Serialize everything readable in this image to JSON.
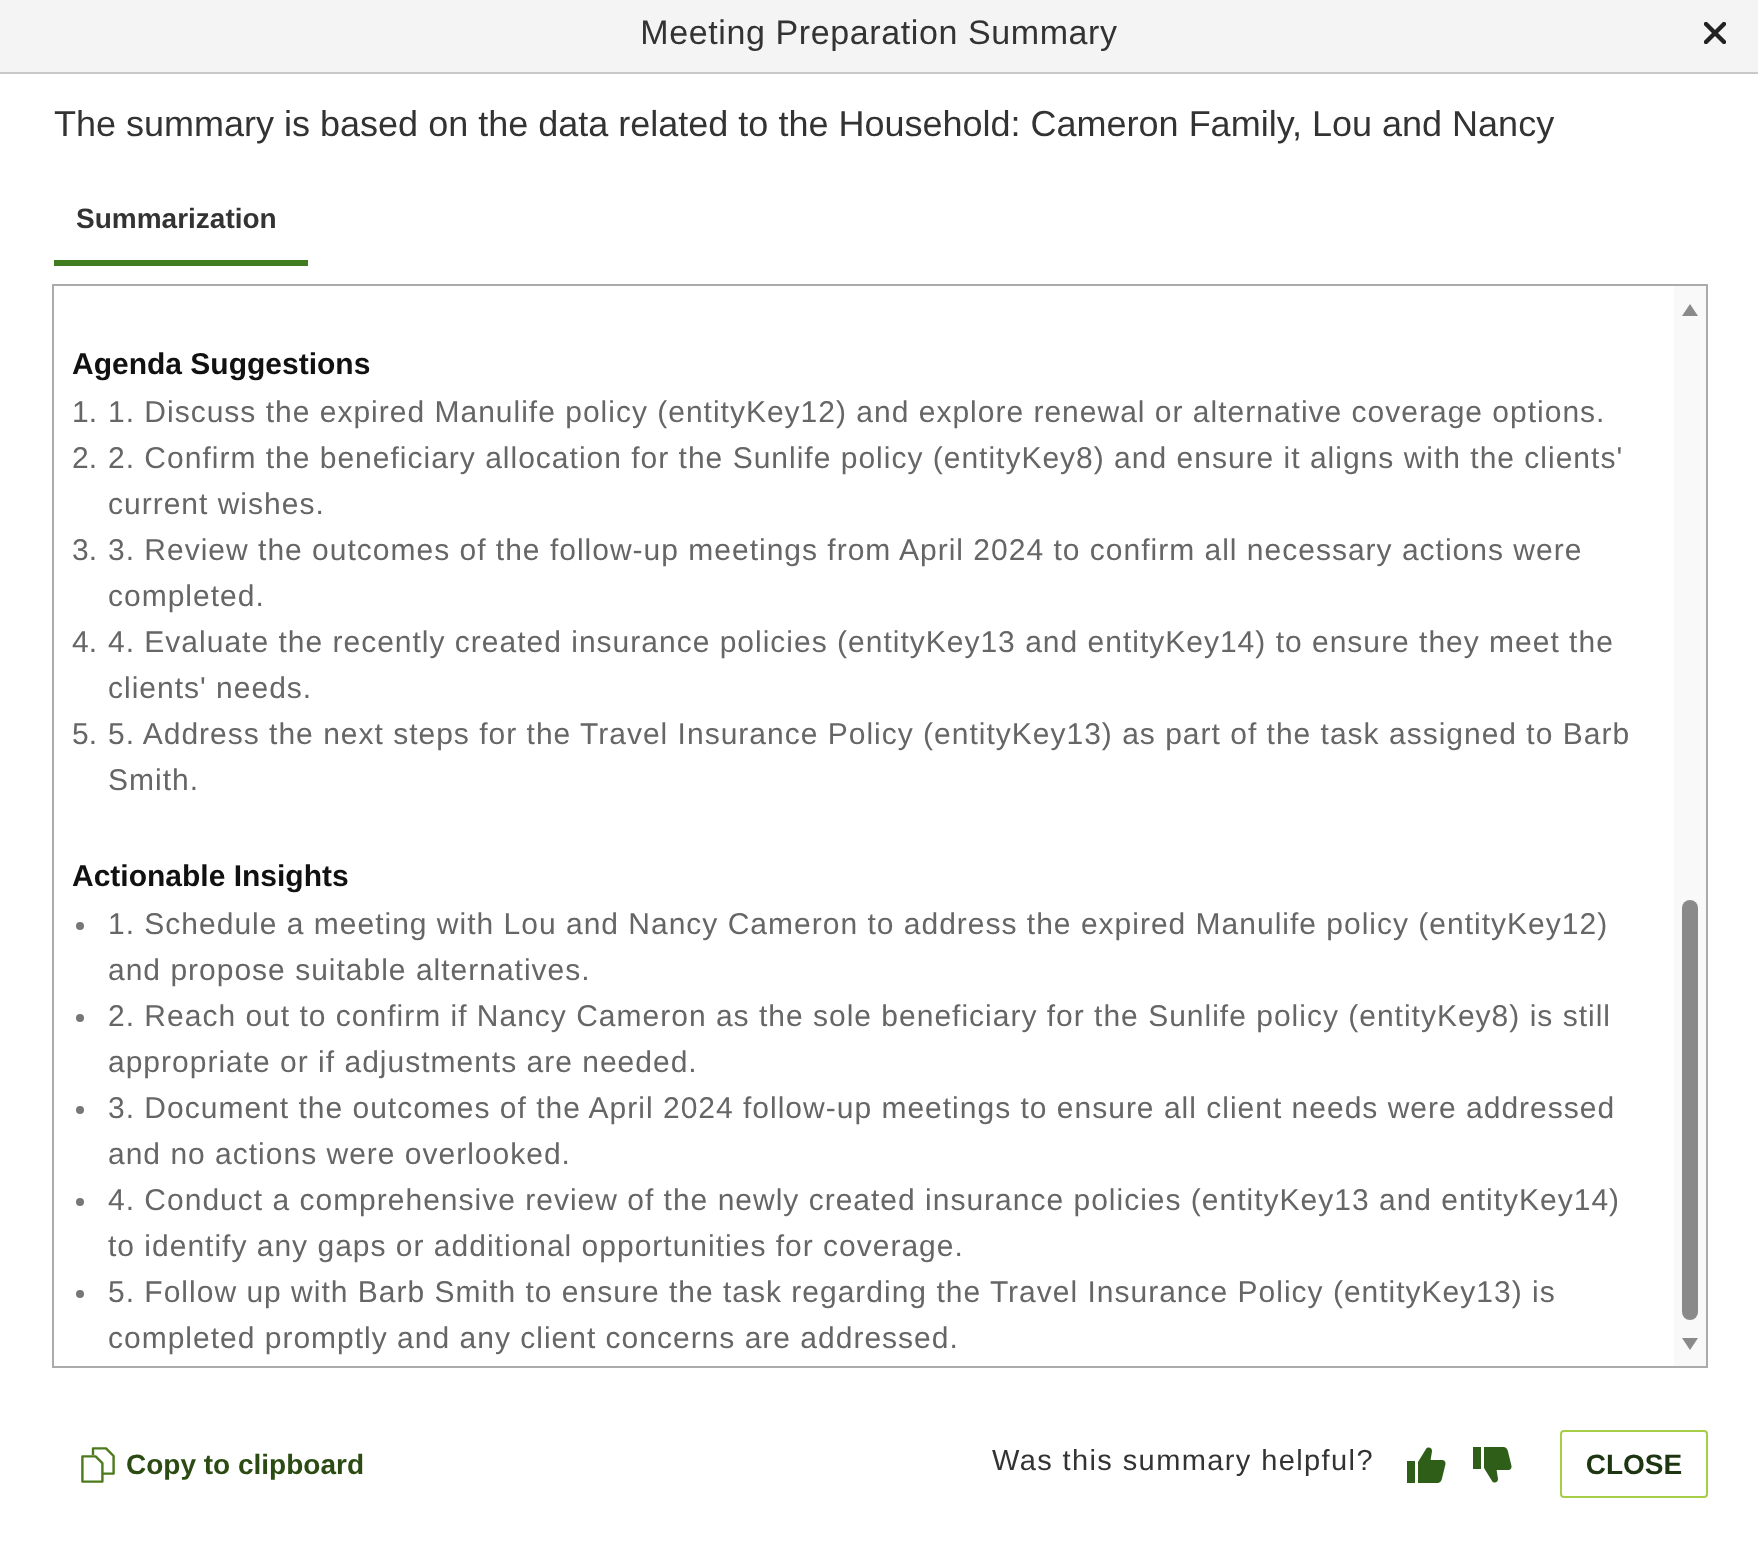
{
  "window": {
    "title": "Meeting Preparation Summary"
  },
  "intro": "The summary is based on the data related to the Household: Cameron Family, Lou and Nancy",
  "tabs": [
    {
      "label": "Summarization",
      "selected": true
    }
  ],
  "sections": [
    {
      "heading": "Agenda Suggestions",
      "kind": "numbered",
      "items": [
        {
          "marker": "1.",
          "text": "1. Discuss the expired Manulife policy (entityKey12) and explore renewal or alternative coverage options."
        },
        {
          "marker": "2.",
          "text": "2. Confirm the beneficiary allocation for the Sunlife policy (entityKey8) and ensure it aligns with the clients' current wishes."
        },
        {
          "marker": "3.",
          "text": "3. Review the outcomes of the follow-up meetings from April 2024 to confirm all necessary actions were completed."
        },
        {
          "marker": "4.",
          "text": "4. Evaluate the recently created insurance policies (entityKey13 and entityKey14) to ensure they meet the clients' needs."
        },
        {
          "marker": "5.",
          "text": "5. Address the next steps for the Travel Insurance Policy (entityKey13) as part of the task assigned to Barb Smith."
        }
      ]
    },
    {
      "heading": "Actionable Insights",
      "kind": "bulleted",
      "items": [
        {
          "text": "1. Schedule a meeting with Lou and Nancy Cameron to address the expired Manulife policy (entityKey12) and propose suitable alternatives."
        },
        {
          "text": "2. Reach out to confirm if Nancy Cameron as the sole beneficiary for the Sunlife policy (entityKey8) is still appropriate or if adjustments are needed."
        },
        {
          "text": "3. Document the outcomes of the April 2024 follow-up meetings to ensure all client needs were addressed and no actions were overlooked."
        },
        {
          "text": "4. Conduct a comprehensive review of the newly created insurance policies (entityKey13 and entityKey14) to identify any gaps or additional opportunities for coverage."
        },
        {
          "text": "5. Follow up with Barb Smith to ensure the task regarding the Travel Insurance Policy (entityKey13) is completed promptly and any client concerns are addressed."
        }
      ]
    }
  ],
  "footer": {
    "copy_link": "Copy to clipboard",
    "feedback_prompt": "Was this summary helpful?",
    "close_button": "CLOSE"
  }
}
